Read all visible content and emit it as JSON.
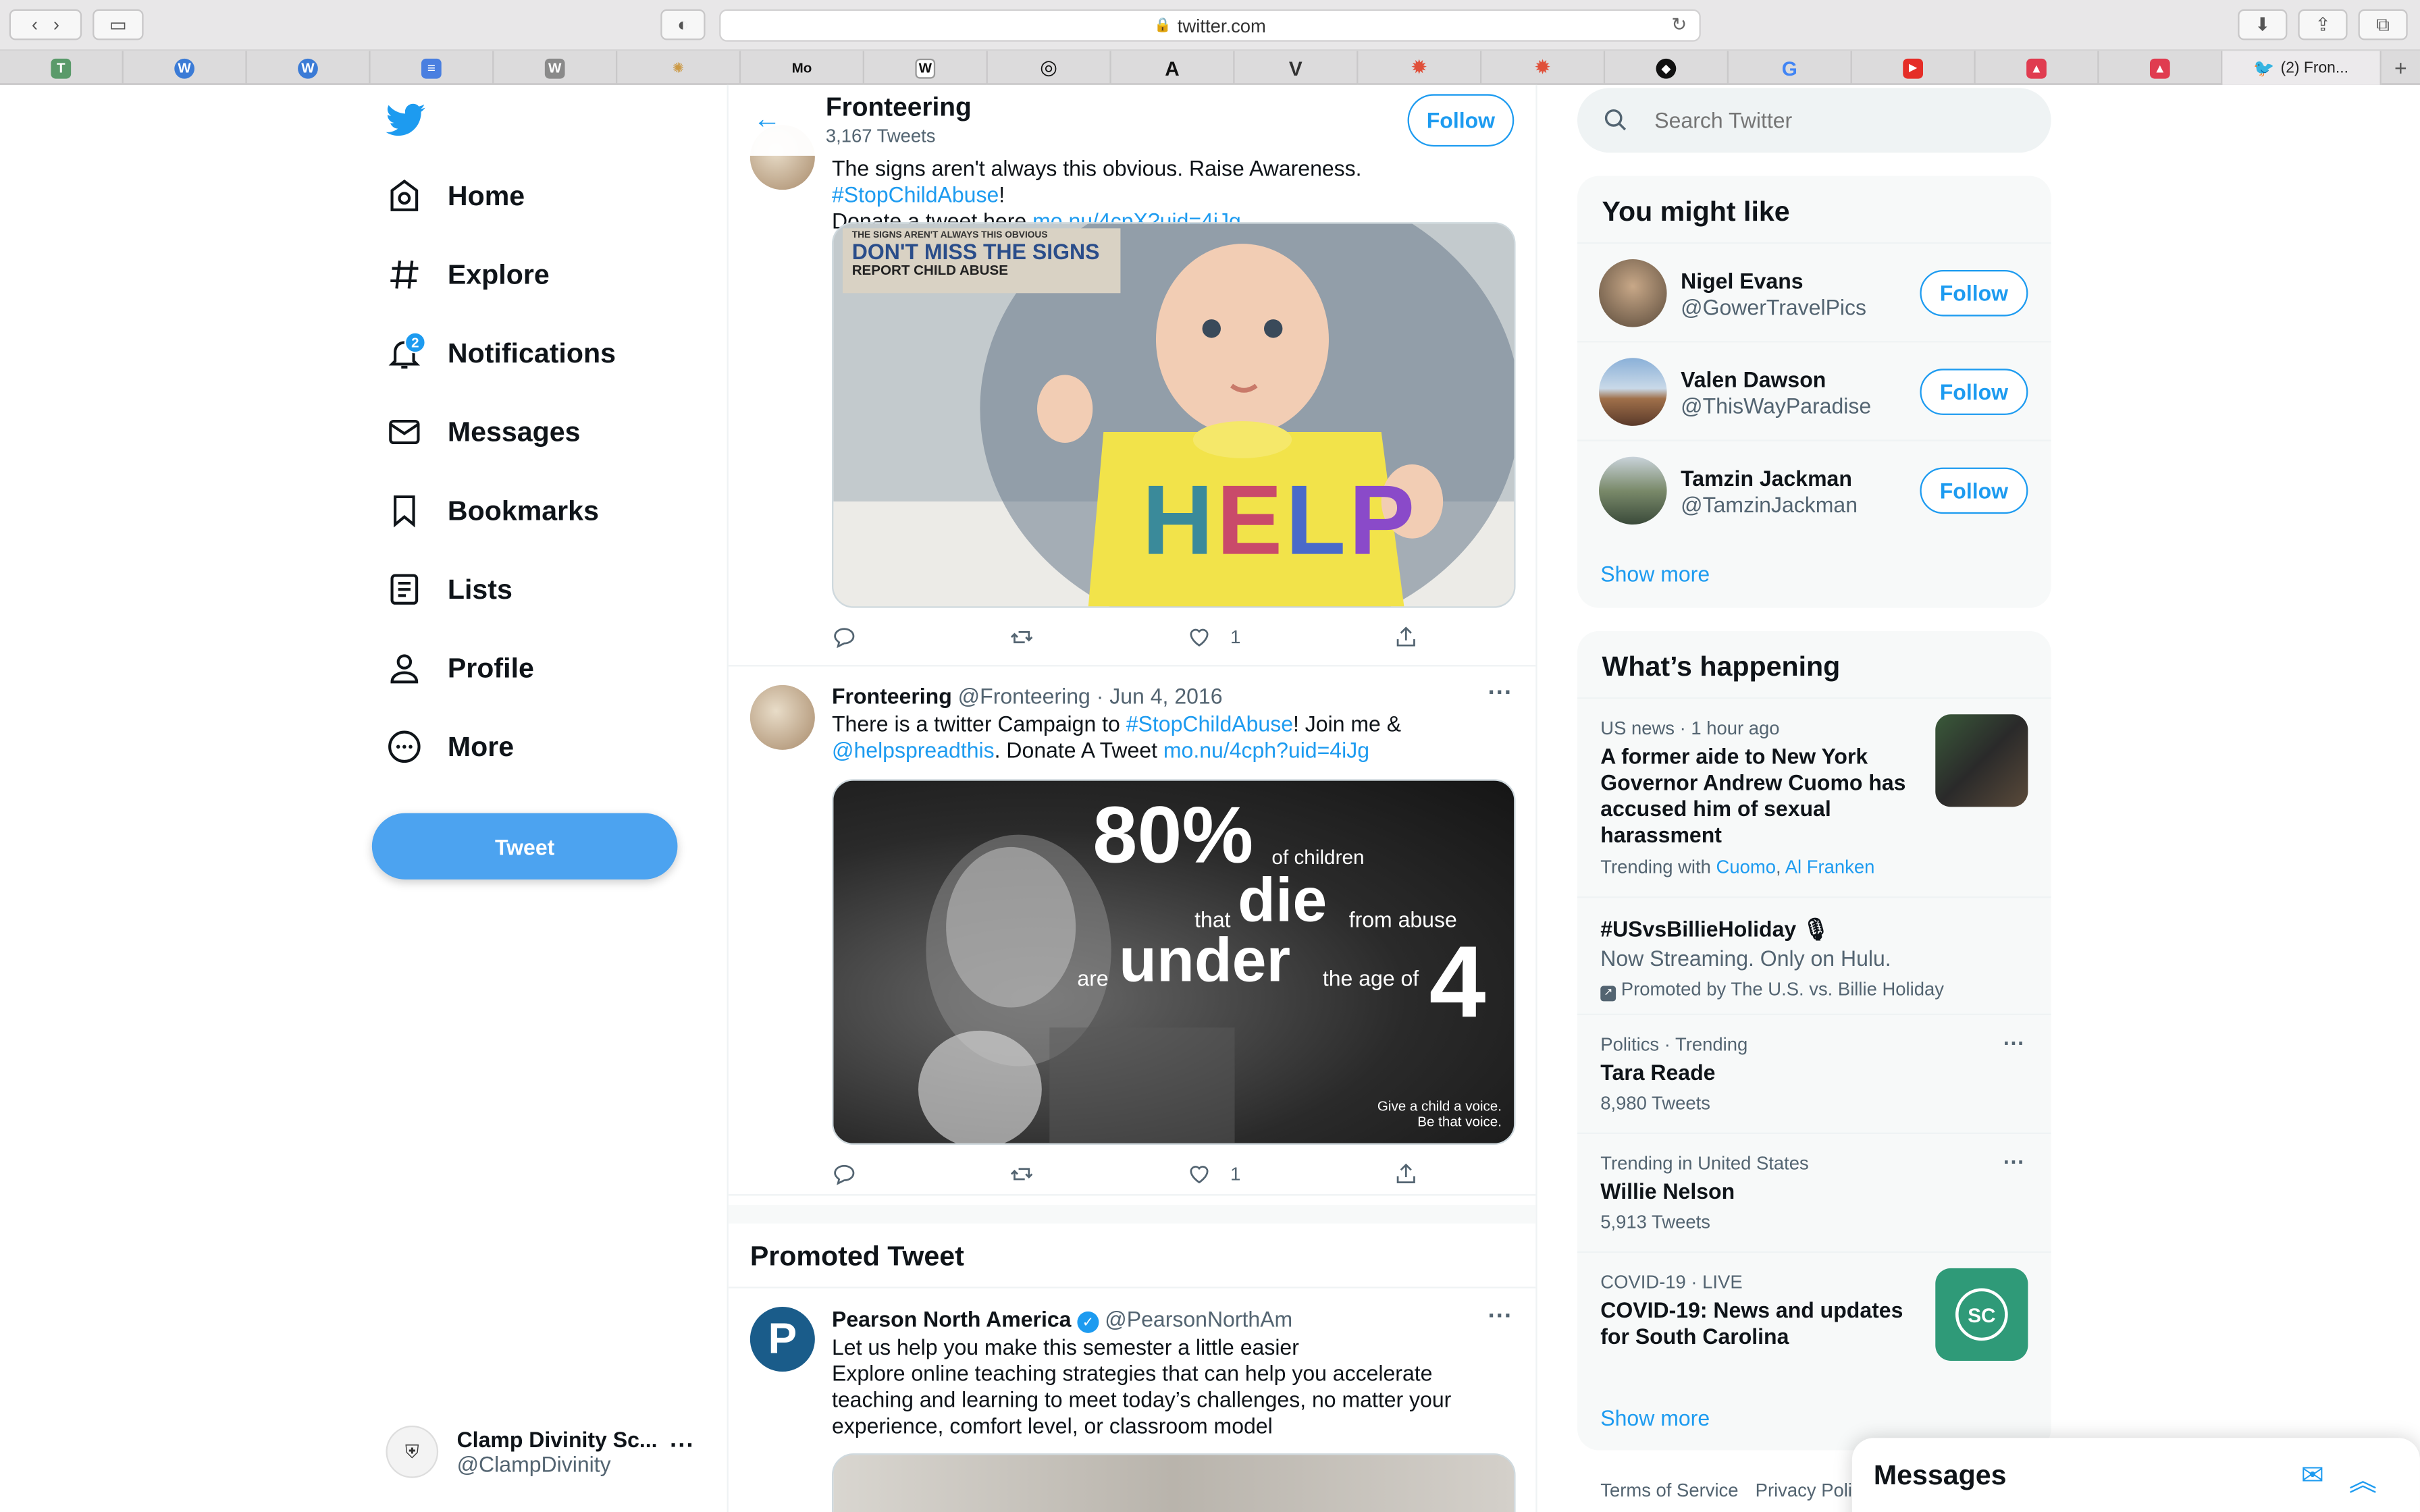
{
  "browser": {
    "url": "twitter.com",
    "active_tab": "(2) Fron...",
    "favorites": [
      "T",
      "W",
      "W",
      "≡",
      "W",
      "✺",
      "Mo",
      "W",
      "◎",
      "A",
      "V",
      "✹",
      "✹",
      "◆",
      "G",
      "▶",
      "▲",
      "▲"
    ]
  },
  "nav": {
    "items": [
      "Home",
      "Explore",
      "Notifications",
      "Messages",
      "Bookmarks",
      "Lists",
      "Profile",
      "More"
    ],
    "notif_badge": "2",
    "tweet_label": "Tweet"
  },
  "account": {
    "name": "Clamp Divinity Sc...",
    "handle": "@ClampDivinity"
  },
  "header": {
    "title": "Fronteering",
    "subtitle": "3,167 Tweets",
    "follow_label": "Follow"
  },
  "tweets": [
    {
      "text_a": "The signs aren't always this obvious. Raise Awareness. ",
      "hashtag": "#StopChildAbuse",
      "text_b": "!",
      "text_c": "Donate a tweet here  ",
      "link": "mo.nu/4cpX?uid=4iJg",
      "poster_top": "THE SIGNS AREN'T ALWAYS THIS OBVIOUS",
      "poster_mid": "DON'T MISS THE SIGNS",
      "poster_bot": "REPORT CHILD ABUSE",
      "bib": [
        "H",
        "E",
        "L",
        "P"
      ],
      "likes": "1"
    },
    {
      "name": "Fronteering",
      "handle": "@Fronteering",
      "date": "· Jun 4, 2016",
      "text_a": "There is a twitter Campaign to ",
      "hashtag": "#StopChildAbuse",
      "text_b": "! Join me &",
      "mention": "@helpspreadthis",
      "text_c": ". Donate A Tweet  ",
      "link": "mo.nu/4cph?uid=4iJg",
      "img_pct": "80%",
      "img_of": "of children",
      "img_that": "that",
      "img_die": "die",
      "img_from": "from abuse",
      "img_are": "are",
      "img_under": "under",
      "img_age": "the age of",
      "img_four": "4",
      "img_give": "Give a child a voice.",
      "img_be": "Be that voice.",
      "likes": "1"
    }
  ],
  "promoted": {
    "heading": "Promoted Tweet",
    "name": "Pearson North America",
    "handle": "@PearsonNorthAm",
    "line1": "Let us help you make this semester a little easier",
    "line2": "Explore online teaching strategies that can help you accelerate teaching and learning to meet today’s challenges, no matter your experience, comfort level, or classroom model",
    "avatar_letter": "P"
  },
  "search": {
    "placeholder": "Search Twitter"
  },
  "you_might_like": {
    "title": "You might like",
    "users": [
      {
        "name": "Nigel Evans",
        "handle": "@GowerTravelPics",
        "follow": "Follow"
      },
      {
        "name": "Valen Dawson",
        "handle": "@ThisWayParadise",
        "follow": "Follow"
      },
      {
        "name": "Tamzin Jackman",
        "handle": "@TamzinJackman",
        "follow": "Follow"
      }
    ],
    "show_more": "Show more"
  },
  "happening": {
    "title": "What’s happening",
    "trends": [
      {
        "meta": "US news · 1 hour ago",
        "title": "A former aide to New York Governor Andrew Cuomo has accused him of sexual harassment",
        "with_label": "Trending with ",
        "with_a": "Cuomo",
        "with_sep": ", ",
        "with_b": "Al Franken"
      },
      {
        "title": "#USvsBillieHoliday 🎙",
        "sub": "Now Streaming. Only on Hulu.",
        "promo": "Promoted by The U.S. vs. Billie Holiday"
      },
      {
        "meta": "Politics · Trending",
        "title": "Tara Reade",
        "sub": "8,980 Tweets"
      },
      {
        "meta": "Trending in United States",
        "title": "Willie Nelson",
        "sub": "5,913 Tweets"
      },
      {
        "meta": "COVID-19 · LIVE",
        "title": "COVID-19: News and updates for South Carolina",
        "img_text": "SC"
      }
    ],
    "show_more": "Show more"
  },
  "footer": {
    "terms": "Terms of Service",
    "privacy": "Privacy Polic"
  },
  "messages_drawer": {
    "title": "Messages"
  },
  "colors": {
    "accent": "#1d9bf0",
    "text": "#0f1419",
    "muted": "#536471"
  }
}
